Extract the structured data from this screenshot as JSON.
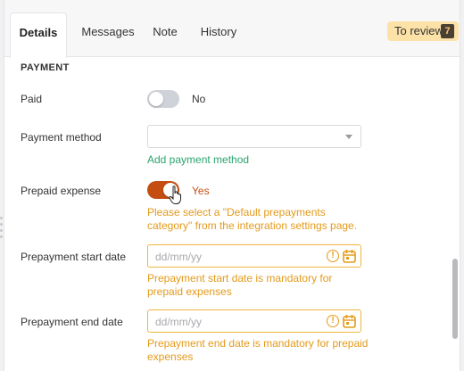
{
  "tabs": [
    {
      "label": "Details",
      "active": true
    },
    {
      "label": "Messages",
      "active": false
    },
    {
      "label": "Note",
      "active": false
    },
    {
      "label": "History",
      "active": false
    }
  ],
  "review": {
    "label": "To review",
    "count": "7"
  },
  "section": {
    "title": "PAYMENT"
  },
  "paid": {
    "label": "Paid",
    "state": "No"
  },
  "payment_method": {
    "label": "Payment method",
    "value": "",
    "add_link": "Add payment method"
  },
  "prepaid": {
    "label": "Prepaid expense",
    "state": "Yes",
    "warning_line1": "Please select a \"Default prepayments",
    "warning_line2": "category\" from the integration settings page."
  },
  "start_date": {
    "label": "Prepayment start date",
    "placeholder": "dd/mm/yy",
    "error_line1": "Prepayment start date is mandatory for",
    "error_line2": "prepaid expenses"
  },
  "end_date": {
    "label": "Prepayment end date",
    "placeholder": "dd/mm/yy",
    "error_line1": "Prepayment end date is mandatory for prepaid",
    "error_line2": "expenses"
  },
  "colors": {
    "accent_green": "#2aa56e",
    "toggle_on": "#c44e12",
    "warning": "#e39a1a",
    "review_bg": "#fde2a8"
  },
  "icons": {
    "dropdown": "chevron-down-icon",
    "alert": "alert-circle-icon",
    "calendar": "calendar-icon",
    "cursor": "hand-pointer-icon"
  }
}
